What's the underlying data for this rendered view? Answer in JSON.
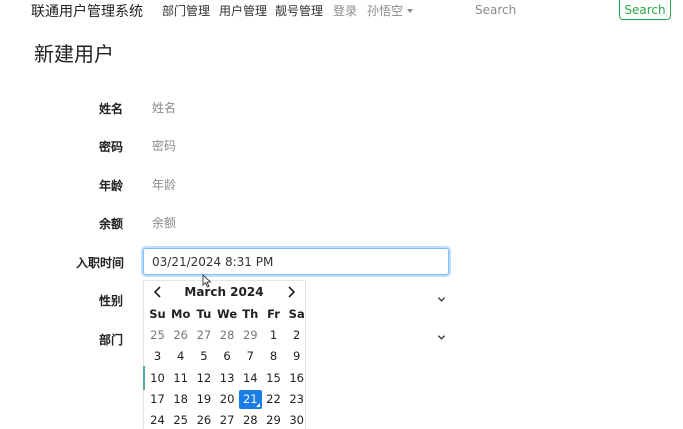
{
  "navbar": {
    "brand": "联通用户管理系统",
    "links": [
      "部门管理",
      "用户管理",
      "靓号管理"
    ],
    "login": "登录",
    "user": "孙悟空",
    "search_placeholder": "Search",
    "search_button": "Search"
  },
  "page": {
    "title": "新建用户"
  },
  "form": {
    "name": {
      "label": "姓名",
      "placeholder": "姓名"
    },
    "password": {
      "label": "密码",
      "placeholder": "密码"
    },
    "age": {
      "label": "年龄",
      "placeholder": "年龄"
    },
    "balance": {
      "label": "余额",
      "placeholder": "余额"
    },
    "hire_time": {
      "label": "入职时间",
      "value": "03/21/2024 8:31 PM"
    },
    "gender": {
      "label": "性别"
    },
    "department": {
      "label": "部门"
    }
  },
  "datepicker": {
    "title": "March 2024",
    "weekdays": [
      "Su",
      "Mo",
      "Tu",
      "We",
      "Th",
      "Fr",
      "Sa"
    ],
    "rows": [
      [
        {
          "d": "25",
          "old": true
        },
        {
          "d": "26",
          "old": true
        },
        {
          "d": "27",
          "old": true
        },
        {
          "d": "28",
          "old": true
        },
        {
          "d": "29",
          "old": true
        },
        {
          "d": "1"
        },
        {
          "d": "2"
        }
      ],
      [
        {
          "d": "3"
        },
        {
          "d": "4"
        },
        {
          "d": "5"
        },
        {
          "d": "6"
        },
        {
          "d": "7"
        },
        {
          "d": "8"
        },
        {
          "d": "9"
        }
      ],
      [
        {
          "d": "10"
        },
        {
          "d": "11"
        },
        {
          "d": "12"
        },
        {
          "d": "13"
        },
        {
          "d": "14"
        },
        {
          "d": "15"
        },
        {
          "d": "16"
        }
      ],
      [
        {
          "d": "17"
        },
        {
          "d": "18"
        },
        {
          "d": "19"
        },
        {
          "d": "20"
        },
        {
          "d": "21",
          "active": true
        },
        {
          "d": "22"
        },
        {
          "d": "23"
        }
      ],
      [
        {
          "d": "24"
        },
        {
          "d": "25"
        },
        {
          "d": "26"
        },
        {
          "d": "27"
        },
        {
          "d": "28"
        },
        {
          "d": "29"
        },
        {
          "d": "30"
        }
      ]
    ]
  },
  "colors": {
    "accent_green": "#28a745",
    "selected_day": "#1a7ee6",
    "focus_border": "#80bdff"
  }
}
